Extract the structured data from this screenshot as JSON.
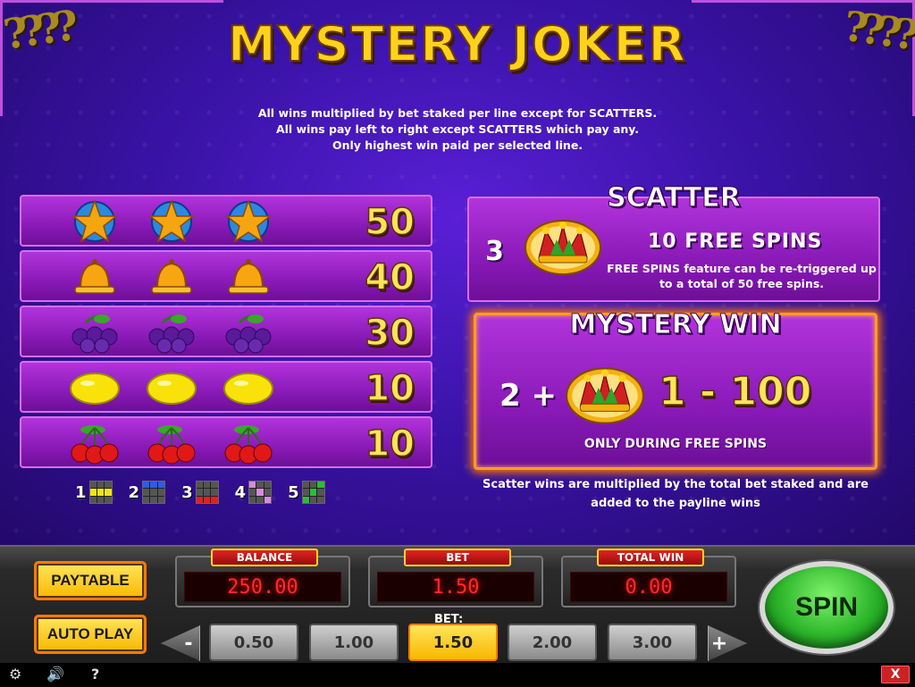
{
  "title": "MYSTERY JOKER",
  "rules": [
    "All wins multiplied by bet staked per line except for SCATTERS.",
    "All wins pay left to right except SCATTERS which pay any.",
    "Only highest win paid per selected line."
  ],
  "paytable": [
    {
      "symbol": "star-icon",
      "amount": "50"
    },
    {
      "symbol": "bell-icon",
      "amount": "40"
    },
    {
      "symbol": "plum-icon",
      "amount": "30"
    },
    {
      "symbol": "lemon-icon",
      "amount": "10"
    },
    {
      "symbol": "cherry-icon",
      "amount": "10"
    }
  ],
  "linekey": [
    {
      "num": "1",
      "color": "#f2e21a"
    },
    {
      "num": "2",
      "color": "#2a5cf0"
    },
    {
      "num": "3",
      "color": "#e02020"
    },
    {
      "num": "4",
      "color": "#d88ae0"
    },
    {
      "num": "5",
      "color": "#2abd3a"
    }
  ],
  "scatter": {
    "title": "SCATTER",
    "count": "3",
    "free_spins": "10 FREE SPINS",
    "desc": "FREE SPINS feature can be re-triggered up to a total of 50 free spins."
  },
  "mystery": {
    "title": "MYSTERY WIN",
    "count": "2 +",
    "range": "1 - 100",
    "note": "ONLY DURING FREE SPINS"
  },
  "scatter_note": "Scatter wins are multiplied by the total bet staked and are added to the payline wins",
  "controls": {
    "paytable_label": "PAYTABLE",
    "autoplay_label": "AUTO PLAY",
    "balance_label": "BALANCE",
    "balance_value": "250.00",
    "bet_label": "BET",
    "bet_value": "1.50",
    "totalwin_label": "TOTAL WIN",
    "totalwin_value": "0.00",
    "bet_selector_label": "BET:",
    "bet_options": [
      "0.50",
      "1.00",
      "1.50",
      "2.00",
      "3.00"
    ],
    "active_bet": "1.50",
    "minus_label": "-",
    "plus_label": "+",
    "spin_label": "SPIN"
  },
  "statusbar": {
    "settings_icon": "gear-icon",
    "sound_icon": "speaker-icon",
    "help_label": "?",
    "close_label": "X"
  },
  "colors": {
    "accent_gold": "#ffd21a",
    "panel_purple": "#8a1ab8",
    "spin_green": "#2cb52a",
    "meter_red": "#ff2a2a"
  }
}
